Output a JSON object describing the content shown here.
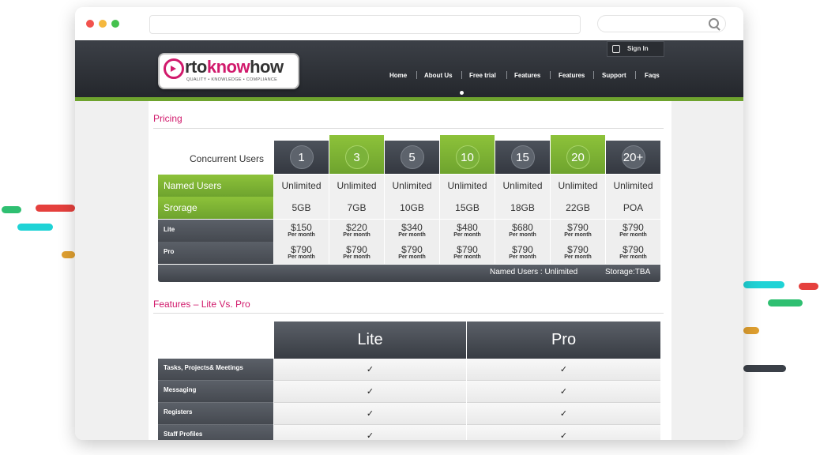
{
  "colors": {
    "accent_green": "#6ea32e",
    "pink": "#d11a6c",
    "dark": "#3c4047"
  },
  "header": {
    "logo_text_pre": "rto",
    "logo_text_know": "know",
    "logo_text_post": "how",
    "logo_tagline": "QUALITY • KNOWLEDGE • COMPLIANCE",
    "sign_in": "Sign In",
    "nav": [
      "Home",
      "About Us",
      "Free trial",
      "Features",
      "Features",
      "Support",
      "Faqs"
    ]
  },
  "pricing": {
    "title": "Pricing",
    "concurrent_label": "Concurrent Users",
    "columns": [
      "1",
      "3",
      "5",
      "10",
      "15",
      "20",
      "20+"
    ],
    "highlighted": [
      false,
      true,
      false,
      true,
      false,
      true,
      false
    ],
    "named_users_label": "Named Users",
    "named_users": [
      "Unlimited",
      "Unlimited",
      "Unlimited",
      "Unlimited",
      "Unlimited",
      "Unlimited",
      "Unlimited"
    ],
    "storage_label": "Srorage",
    "storage": [
      "5GB",
      "7GB",
      "10GB",
      "15GB",
      "18GB",
      "22GB",
      "POA"
    ],
    "lite_label": "Lite",
    "lite": [
      "$150",
      "$220",
      "$340",
      "$480",
      "$680",
      "$790",
      "$790"
    ],
    "pro_label": "Pro",
    "pro": [
      "$790",
      "$790",
      "$790",
      "$790",
      "$790",
      "$790",
      "$790"
    ],
    "per_month": "Per month",
    "footer_named": "Named Users : Unlimited",
    "footer_storage": "Storage:TBA"
  },
  "features": {
    "title": "Features – Lite Vs. Pro",
    "col_lite": "Lite",
    "col_pro": "Pro",
    "rows": [
      {
        "label": "Tasks, Projects& Meetings",
        "lite": "✓",
        "pro": "✓"
      },
      {
        "label": "Messaging",
        "lite": "✓",
        "pro": "✓"
      },
      {
        "label": "Registers",
        "lite": "✓",
        "pro": "✓"
      },
      {
        "label": "Staff Profiles",
        "lite": "✓",
        "pro": "✓"
      }
    ]
  }
}
